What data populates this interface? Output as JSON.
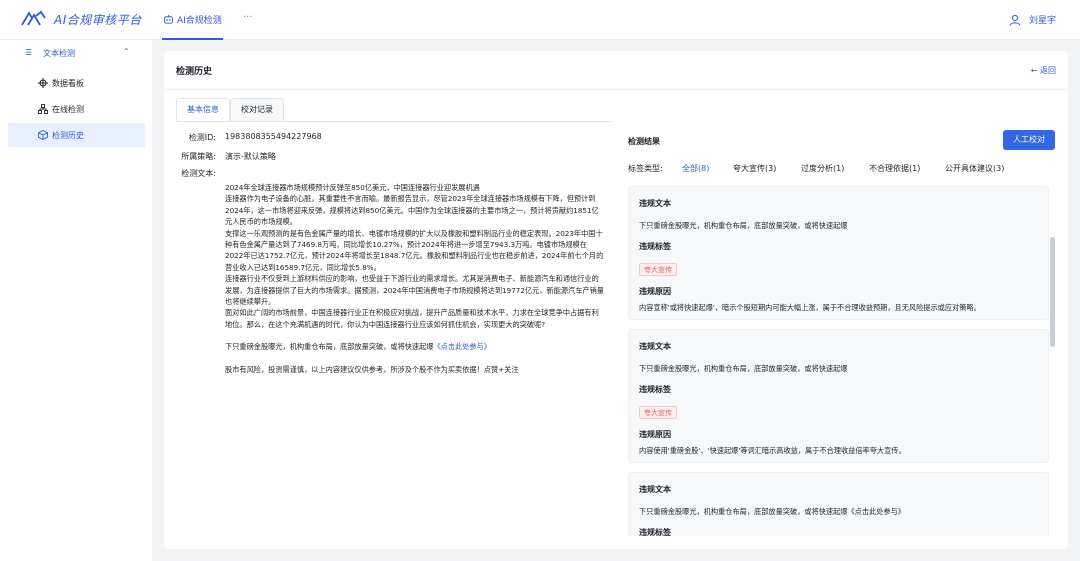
{
  "app": {
    "title": "AI合规审核平台"
  },
  "topnav": {
    "active_tab": "AI合规检测",
    "more": "···",
    "user_name": "刘星宇"
  },
  "sidebar": {
    "group_label": "文本检测",
    "items": [
      {
        "label": "数据看板"
      },
      {
        "label": "在线检测"
      },
      {
        "label": "检测历史"
      }
    ]
  },
  "page": {
    "title": "检测历史",
    "back_label": "返回"
  },
  "tabs": [
    {
      "label": "基本信息"
    },
    {
      "label": "校对记录"
    }
  ],
  "info": {
    "id_label": "检测ID:",
    "id_value": "1983808355494227968",
    "strategy_label": "所属策略:",
    "strategy_value": "演示-默认策略",
    "text_label": "检测文本:",
    "paragraphs": [
      "2024年全球连接器市场规模预计反弹至850亿美元，中国连接器行业迎发展机遇",
      "连接器作为电子设备的心脏，其重要性不言而喻。最新报告显示，尽管2023年全球连接器市场规模有下降，但预计到2024年，这一市场将迎来反弹，规模将达到850亿美元。中国作为全球连接器的主要市场之一，预计将贡献约1851亿元人民币的市场规模。",
      "支撑这一乐观预测的是有色金属产量的增长、电镀市场规模的扩大以及橡胶和塑料制品行业的稳定表现。2023年中国十种有色金属产量达到了7469.8万吨，同比增长10.27%，预计2024年将进一步增至7943.3万吨。电镀市场规模在2022年已达1752.7亿元，预计2024年将增长至1848.7亿元。橡胶和塑料制品行业也在稳步前进，2024年前七个月的营业收入已达到16589.7亿元，同比增长5.8%。",
      "连接器行业不仅受到上游材料供应的影响，也受益于下游行业的需求增长。尤其是消费电子、新能源汽车和通信行业的发展，为连接器提供了巨大的市场需求。据预测，2024年中国消费电子市场规模将达到19772亿元，新能源汽车产销量也将继续攀升。",
      "面对如此广阔的市场前景，中国连接器行业正在积极应对挑战，提升产品质量和技术水平，力求在全球竞争中占据有利地位。那么，在这个充满机遇的时代，你认为中国连接器行业应该如何抓住机会，实现更大的突破呢?"
    ],
    "promo_text": "下只重磅金股曝光，机构重仓布局，底部放量突破，或将快速起爆",
    "promo_link": "《点击此处参与》",
    "disclaimer": "股市有风险，投资需谨慎，以上内容建议仅供参考，所涉及个股不作为买卖依据！点赞+关注"
  },
  "results": {
    "title": "检测结果",
    "review_button": "人工校对",
    "tag_type_label": "标签类型:",
    "filters": [
      {
        "label": "全部(8)"
      },
      {
        "label": "夸大宣传(3)"
      },
      {
        "label": "过度分析(1)"
      },
      {
        "label": "不合理依据(1)"
      },
      {
        "label": "公开具体建议(3)"
      }
    ],
    "cards": [
      {
        "text_label": "违规文本",
        "text": "下只重磅金股曝光，机构重仓布局，底部放量突破，或将快速起爆",
        "tag_label": "违规标签",
        "tag": "夸大宣传",
        "reason_label": "违规原因",
        "reason": "内容宣称'或将快速起爆'，暗示个股短期内可能大幅上涨，属于不合理收益预期，且无风险提示或应对策略。"
      },
      {
        "text_label": "违规文本",
        "text": "下只重磅金股曝光，机构重仓布局，底部放量突破，或将快速起爆",
        "tag_label": "违规标签",
        "tag": "夸大宣传",
        "reason_label": "违规原因",
        "reason": "内容使用'重磅金股'、'快速起爆'等词汇暗示高收益，属于不合理收益倍率夸大宣传。"
      },
      {
        "text_label": "违规文本",
        "text": "下只重磅金股曝光，机构重仓布局，底部放量突破，或将快速起爆《点击此处参与》",
        "tag_label": "违规标签"
      }
    ]
  },
  "colors": {
    "accent": "#2e5bd9",
    "button": "#3467e4",
    "badge_text": "#e06464"
  }
}
